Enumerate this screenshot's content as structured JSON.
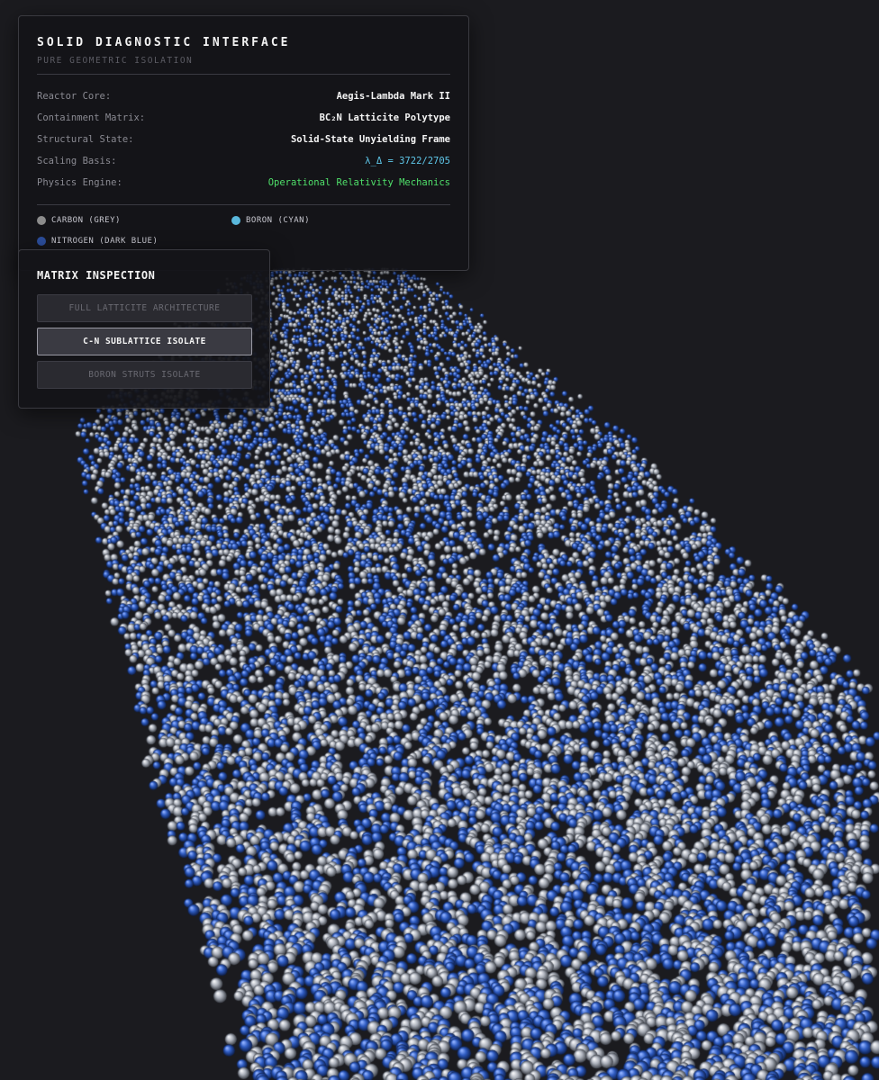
{
  "diagnostic": {
    "title": "SOLID DIAGNOSTIC INTERFACE",
    "subtitle": "PURE GEOMETRIC ISOLATION",
    "rows": [
      {
        "label": "Reactor Core:",
        "value": "Aegis-Lambda Mark II",
        "style": "default"
      },
      {
        "label": "Containment Matrix:",
        "value": "BC₂N Latticite Polytype",
        "style": "default"
      },
      {
        "label": "Structural State:",
        "value": "Solid-State Unyielding Frame",
        "style": "default"
      },
      {
        "label": "Scaling Basis:",
        "value": "λ_Δ = 3722/2705",
        "style": "cyan"
      },
      {
        "label": "Physics Engine:",
        "value": "Operational Relativity Mechanics",
        "style": "green"
      }
    ],
    "legend": [
      {
        "label": "CARBON (GREY)",
        "color": "#8c8c8c"
      },
      {
        "label": "BORON (CYAN)",
        "color": "#5ab8dc"
      },
      {
        "label": "NITROGEN (DARK BLUE)",
        "color": "#2c4e9c"
      }
    ]
  },
  "matrix": {
    "title": "MATRIX INSPECTION",
    "buttons": [
      {
        "label": "FULL LATTICITE ARCHITECTURE",
        "active": false
      },
      {
        "label": "C-N SUBLATTICE ISOLATE",
        "active": true
      },
      {
        "label": "BORON STRUTS ISOLATE",
        "active": false
      }
    ]
  },
  "scene": {
    "background": "#1b1b1f",
    "carbon_color": "#b4b8c0",
    "nitrogen_color": "#2f5bbd"
  }
}
